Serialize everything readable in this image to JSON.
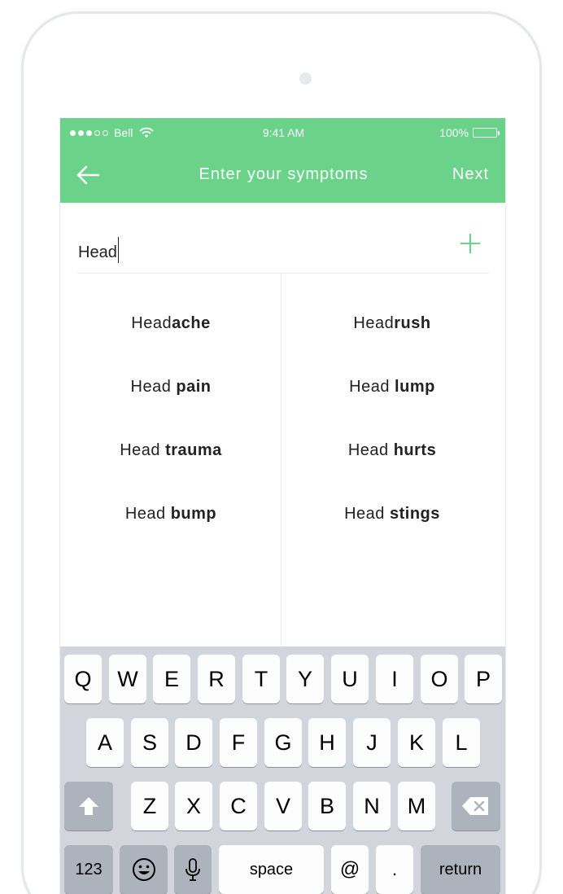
{
  "status": {
    "carrier": "Bell",
    "time": "9:41 AM",
    "battery": "100%"
  },
  "nav": {
    "title": "Enter your symptoms",
    "next_label": "Next"
  },
  "search": {
    "value": "Head"
  },
  "suggestions": {
    "left": [
      {
        "prefix": "Head",
        "suffix": "ache"
      },
      {
        "prefix": "Head ",
        "suffix": "pain"
      },
      {
        "prefix": "Head ",
        "suffix": "trauma"
      },
      {
        "prefix": "Head ",
        "suffix": "bump"
      }
    ],
    "right": [
      {
        "prefix": "Head",
        "suffix": "rush"
      },
      {
        "prefix": "Head ",
        "suffix": "lump"
      },
      {
        "prefix": "Head ",
        "suffix": "hurts"
      },
      {
        "prefix": "Head ",
        "suffix": "stings"
      }
    ]
  },
  "keyboard": {
    "row1": [
      "Q",
      "W",
      "E",
      "R",
      "T",
      "Y",
      "U",
      "I",
      "O",
      "P"
    ],
    "row2": [
      "A",
      "S",
      "D",
      "F",
      "G",
      "H",
      "J",
      "K",
      "L"
    ],
    "row3": [
      "Z",
      "X",
      "C",
      "V",
      "B",
      "N",
      "M"
    ],
    "numbers_label": "123",
    "space_label": "space",
    "at_label": "@",
    "period_label": ".",
    "return_label": "return",
    "icons": {
      "shift": "shift-icon",
      "delete": "delete-icon",
      "emoji": "emoji-icon",
      "mic": "microphone-icon"
    }
  },
  "colors": {
    "accent": "#6ad389",
    "keyboard_bg": "#d2d5db",
    "key_dark": "#acb3bd"
  }
}
